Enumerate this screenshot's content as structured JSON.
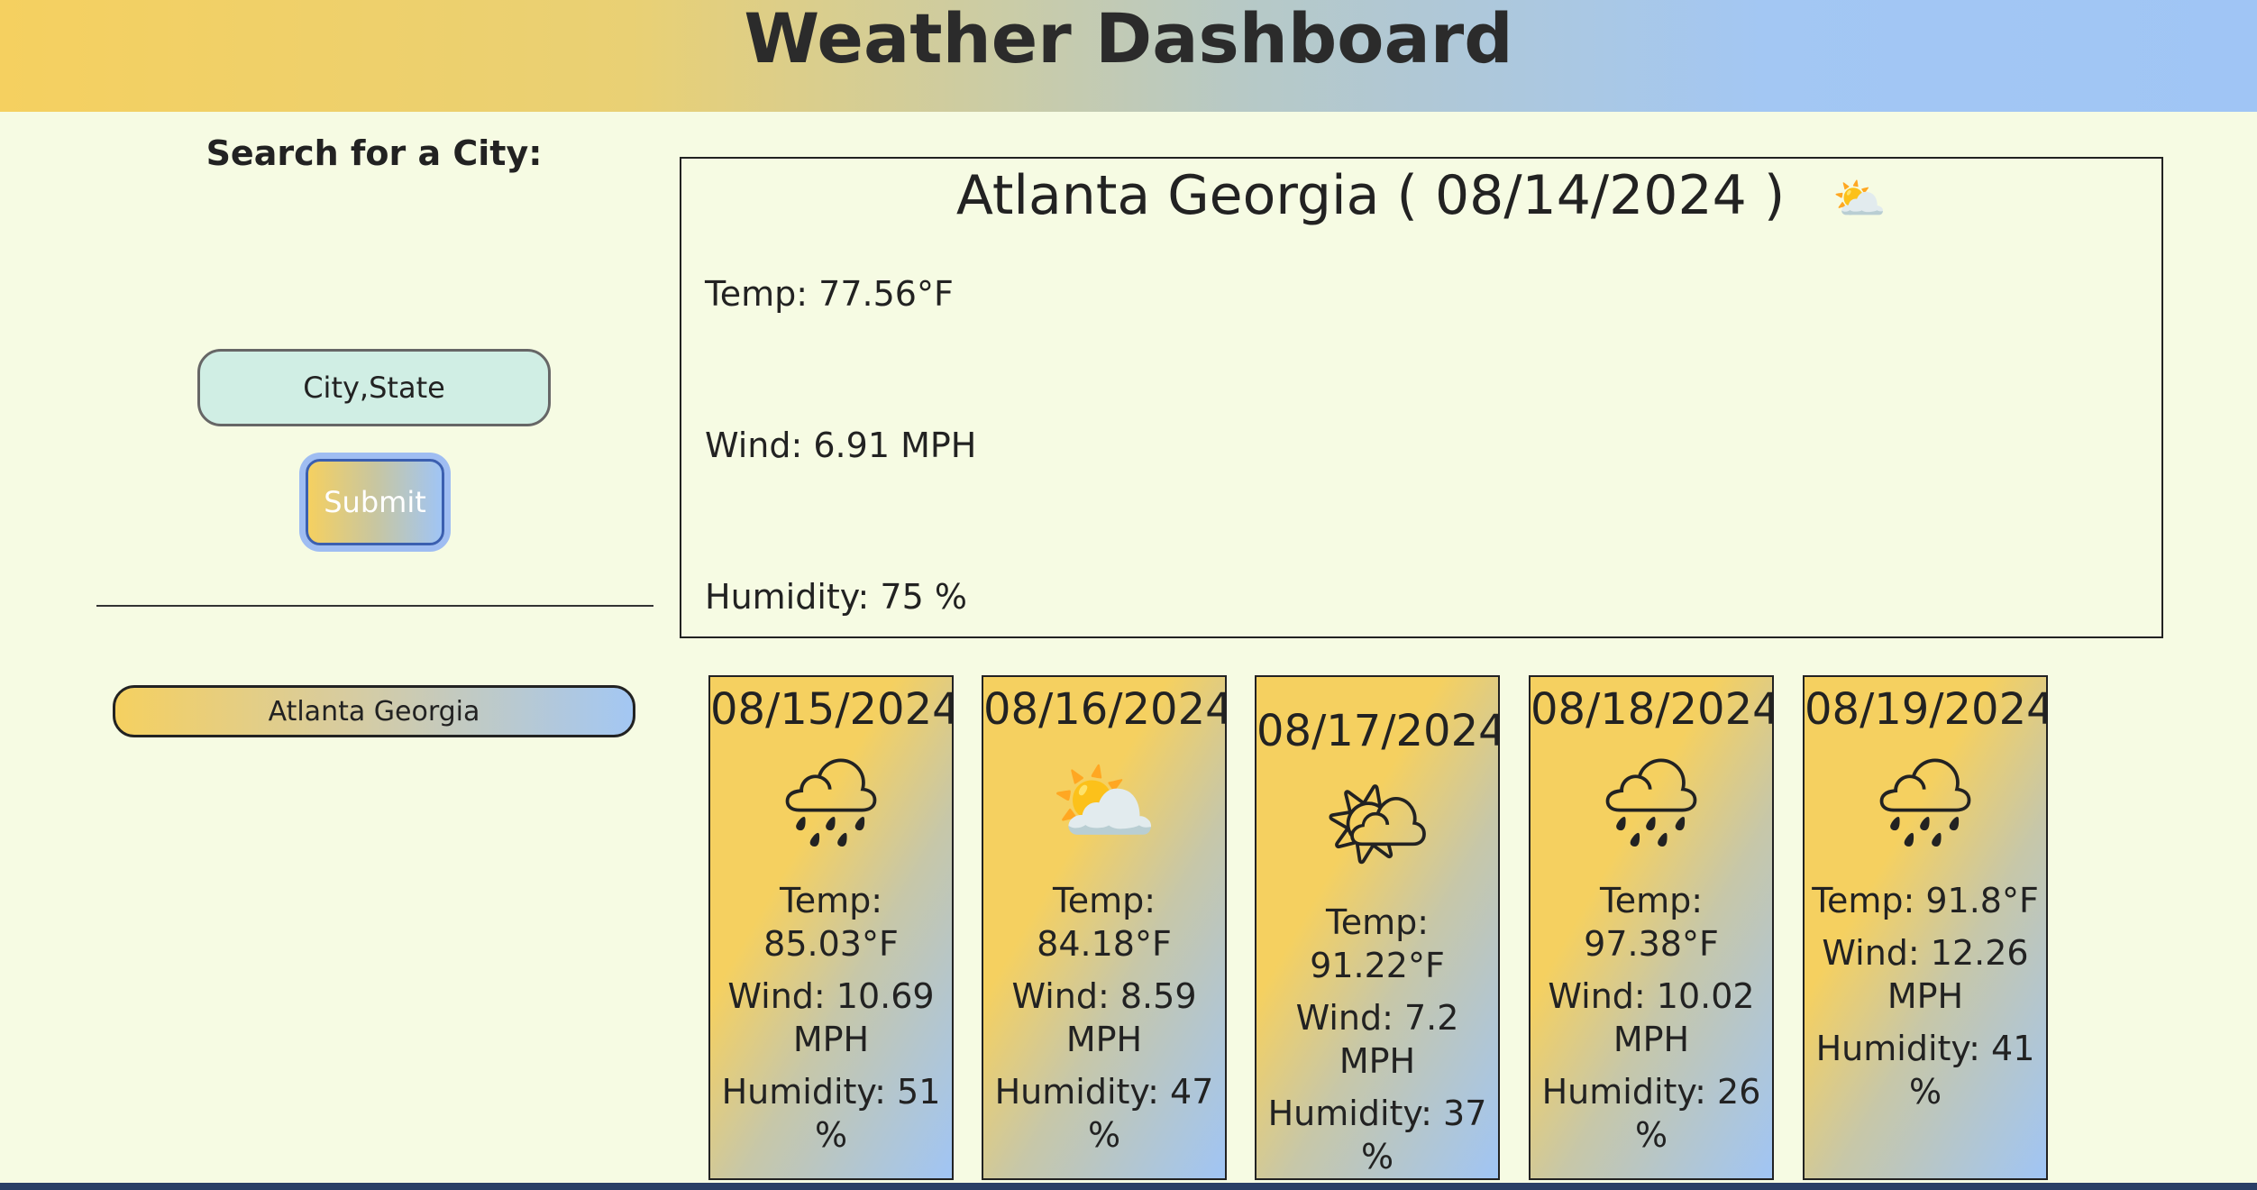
{
  "header": {
    "title": "Weather Dashboard"
  },
  "sidebar": {
    "search_label": "Search for a City:",
    "input_placeholder": "City,State",
    "submit_label": "Submit",
    "history": [
      "Atlanta Georgia"
    ]
  },
  "current": {
    "title": "Atlanta Georgia ( 08/14/2024 )",
    "icon": "⛅",
    "icon_name": "partly-cloudy-icon",
    "temp": "Temp: 77.56°F",
    "wind": "Wind: 6.91 MPH",
    "humidity": "Humidity: 75 %"
  },
  "forecast": [
    {
      "date": "08/15/2024",
      "icon": "🌧",
      "icon_name": "rain-cloud-icon",
      "temp": "Temp: 85.03°F",
      "wind": "Wind: 10.69 MPH",
      "humidity": "Humidity: 51 %"
    },
    {
      "date": "08/16/2024",
      "icon": "⛅",
      "icon_name": "partly-cloudy-icon",
      "temp": "Temp: 84.18°F",
      "wind": "Wind: 8.59 MPH",
      "humidity": "Humidity: 47 %"
    },
    {
      "date": "08/17/2024",
      "icon": "🌤",
      "icon_name": "sun-behind-cloud-icon",
      "temp": "Temp: 91.22°F",
      "wind": "Wind: 7.2 MPH",
      "humidity": "Humidity: 37 %"
    },
    {
      "date": "08/18/2024",
      "icon": "🌧",
      "icon_name": "rain-cloud-icon",
      "temp": "Temp: 97.38°F",
      "wind": "Wind: 10.02 MPH",
      "humidity": "Humidity: 26 %"
    },
    {
      "date": "08/19/2024",
      "icon": "🌧",
      "icon_name": "rain-cloud-icon",
      "temp": "Temp: 91.8°F",
      "wind": "Wind: 12.26 MPH",
      "humidity": "Humidity: 41 %"
    }
  ]
}
